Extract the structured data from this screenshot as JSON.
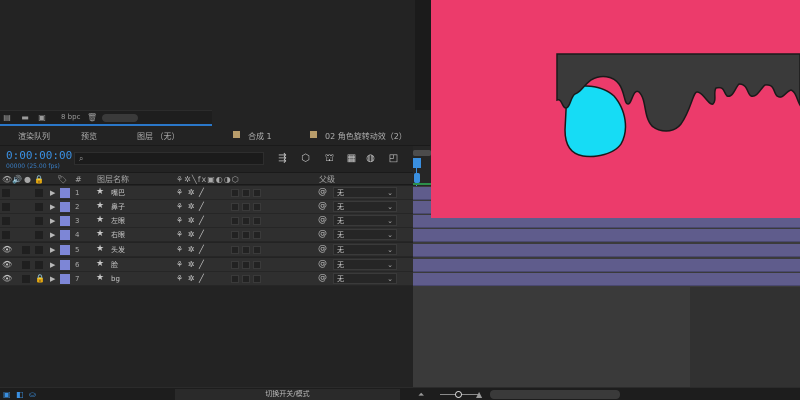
{
  "project_toolbar": {
    "bpc": "8 bpc",
    "icons": [
      "interpret-footage-icon",
      "new-folder-icon",
      "new-composition-icon",
      "trash-icon"
    ]
  },
  "tabs": [
    {
      "label": "渲染队列"
    },
    {
      "label": "预览"
    },
    {
      "label": "图层 （无）"
    },
    {
      "label": "合成 1"
    },
    {
      "label": "02 角色旋转动效（2）"
    }
  ],
  "timeline": {
    "timecode": "0:00:00:00",
    "fps": "00000 (25.00 fps)"
  },
  "columns": {
    "number": "#",
    "layer_name": "图层名称",
    "parent": "父级"
  },
  "layers": [
    {
      "index": "1",
      "name": "嘴巴",
      "parent": "无",
      "visible": false,
      "locked": false
    },
    {
      "index": "2",
      "name": "鼻子",
      "parent": "无",
      "visible": false,
      "locked": false
    },
    {
      "index": "3",
      "name": "左眼",
      "parent": "无",
      "visible": false,
      "locked": false
    },
    {
      "index": "4",
      "name": "右眼",
      "parent": "无",
      "visible": false,
      "locked": false
    },
    {
      "index": "5",
      "name": "头发",
      "parent": "无",
      "visible": true,
      "locked": false
    },
    {
      "index": "6",
      "name": "脸",
      "parent": "无",
      "visible": true,
      "locked": false
    },
    {
      "index": "7",
      "name": "bg",
      "parent": "无",
      "visible": true,
      "locked": true
    }
  ],
  "bottom_bar": {
    "toggle_label": "切换开关/模式"
  },
  "colors": {
    "accent": "#3a8fe0",
    "comp_background": "#ec3b6b",
    "label_color": "#7d86d6",
    "layer_bar": "#5f5c8c",
    "hair": "#3a3a3a",
    "eye": "#16dcf5"
  }
}
